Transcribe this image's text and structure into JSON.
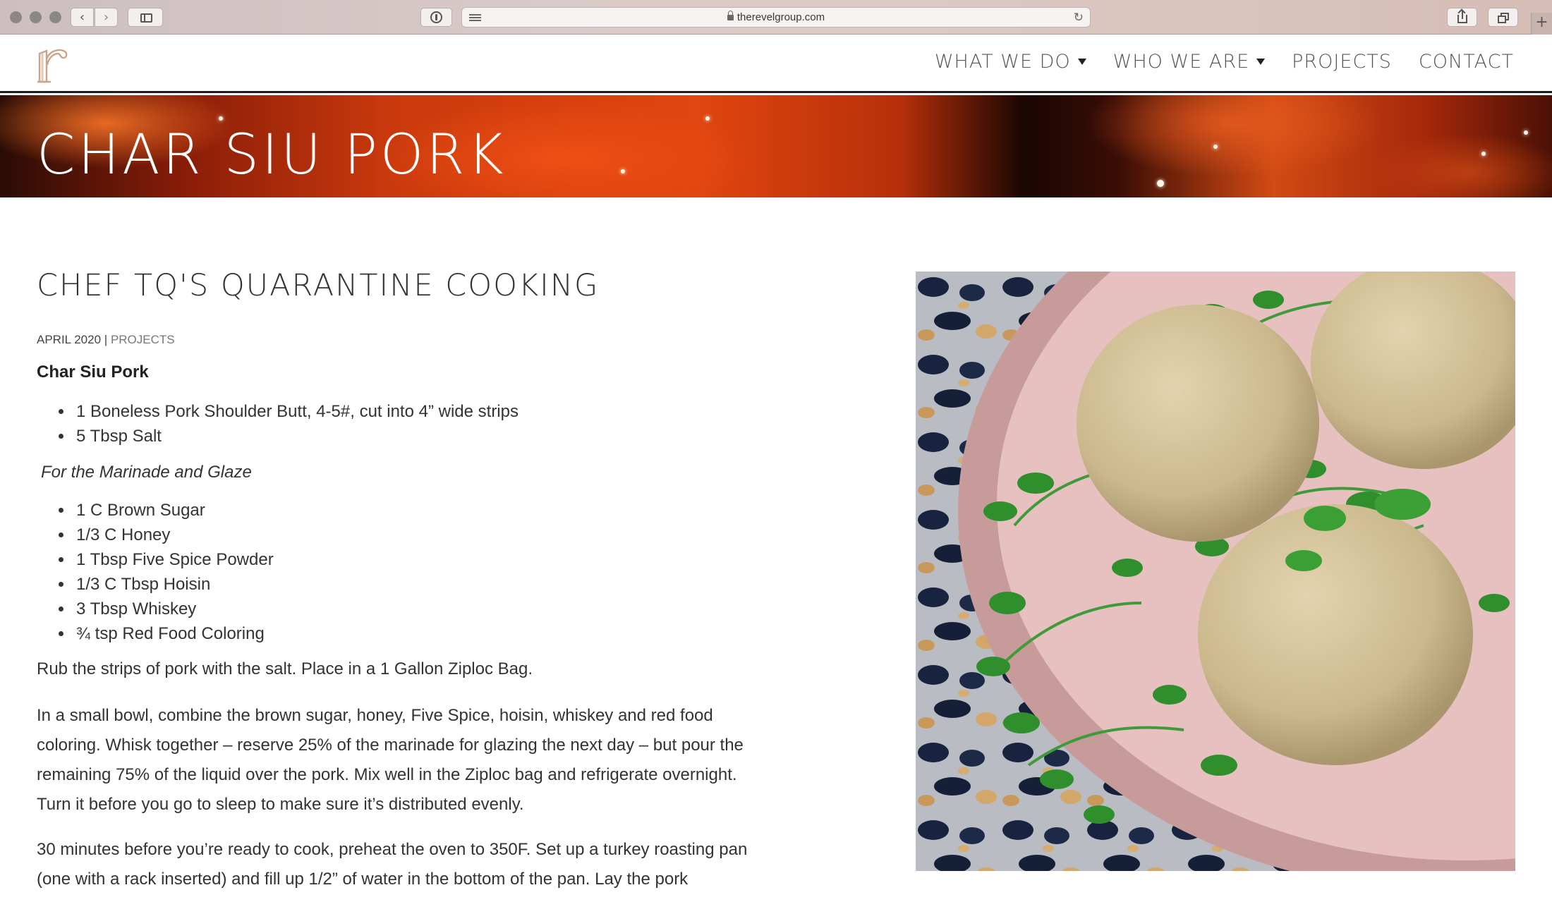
{
  "browser": {
    "url": "therevelgroup.com"
  },
  "site": {
    "logo_letter": "r",
    "nav": [
      {
        "label": "WHAT WE DO",
        "dropdown": true
      },
      {
        "label": "WHO WE ARE",
        "dropdown": true
      },
      {
        "label": "PROJECTS",
        "dropdown": false
      },
      {
        "label": "CONTACT",
        "dropdown": false
      }
    ]
  },
  "hero": {
    "title": "CHAR SIU PORK"
  },
  "article": {
    "title": "CHEF TQ'S QUARANTINE COOKING",
    "date": "APRIL 2020",
    "separator": "|",
    "category": "PROJECTS",
    "recipe_title": "Char Siu Pork",
    "ingredients_main": [
      "1 Boneless Pork Shoulder Butt, 4-5#, cut into 4” wide strips",
      "5 Tbsp Salt"
    ],
    "marinade_heading": "For the Marinade and Glaze",
    "ingredients_marinade": [
      "1 C Brown Sugar",
      "1/3 C Honey",
      "1 Tbsp Five Spice Powder",
      "1/3 C Tbsp Hoisin",
      "3 Tbsp Whiskey",
      "¾ tsp Red Food Coloring"
    ],
    "paragraphs": [
      "Rub the strips of pork with the salt. Place in a 1 Gallon Ziploc Bag.",
      "In a small bowl, combine the brown sugar, honey, Five Spice, hoisin, whiskey and red food coloring. Whisk together – reserve 25% of the marinade for glazing the next day – but pour the remaining 75% of the liquid over the pork. Mix well in the Ziploc bag and refrigerate overnight. Turn it before you go to sleep to make sure it’s distributed evenly.",
      "30 minutes before you’re ready to cook, preheat the oven to 350F. Set up a turkey roasting pan (one with a rack inserted) and fill up 1/2” of water in the bottom of the pan. Lay the pork"
    ]
  },
  "colors": {
    "accent_logo": "#c9a48a",
    "nav_text": "#555555",
    "header_rule": "#1d1d1d"
  }
}
